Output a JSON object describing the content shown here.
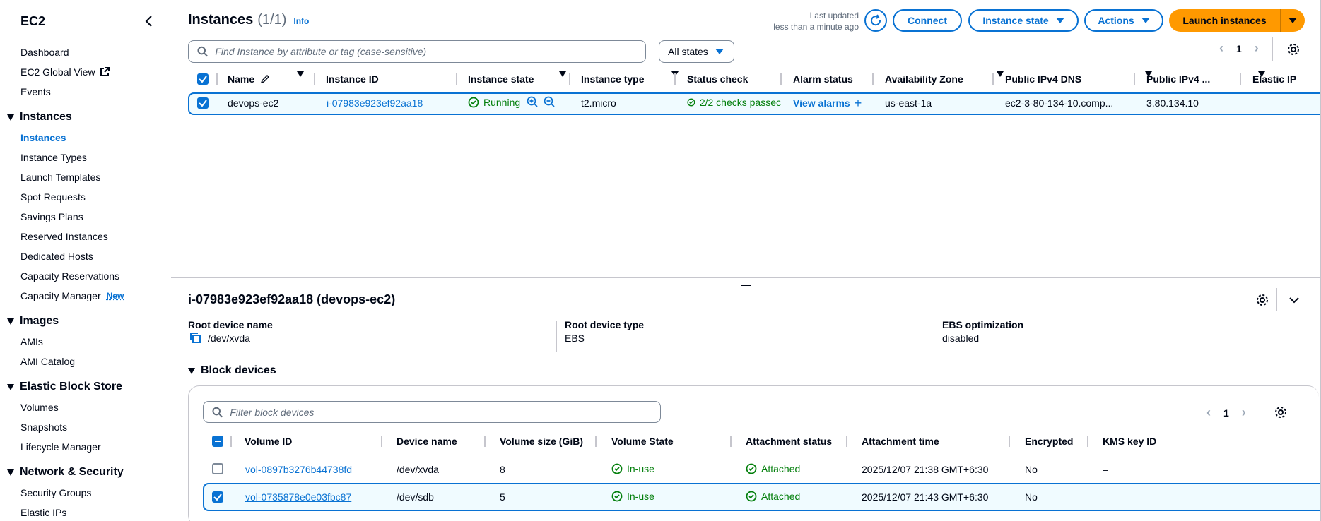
{
  "sidebar": {
    "title": "EC2",
    "top_items": [
      "Dashboard",
      "EC2 Global View",
      "Events"
    ],
    "sections": [
      {
        "title": "Instances",
        "items": [
          "Instances",
          "Instance Types",
          "Launch Templates",
          "Spot Requests",
          "Savings Plans",
          "Reserved Instances",
          "Dedicated Hosts",
          "Capacity Reservations",
          "Capacity Manager"
        ]
      },
      {
        "title": "Images",
        "items": [
          "AMIs",
          "AMI Catalog"
        ]
      },
      {
        "title": "Elastic Block Store",
        "items": [
          "Volumes",
          "Snapshots",
          "Lifecycle Manager"
        ]
      },
      {
        "title": "Network & Security",
        "items": [
          "Security Groups",
          "Elastic IPs"
        ]
      }
    ],
    "new_badge": "New"
  },
  "header": {
    "title": "Instances",
    "count": "(1/1)",
    "info": "Info",
    "last_updated_label": "Last updated",
    "last_updated_value": "less than a minute ago",
    "connect": "Connect",
    "instance_state": "Instance state",
    "actions": "Actions",
    "launch": "Launch instances"
  },
  "search": {
    "placeholder": "Find Instance by attribute or tag (case-sensitive)",
    "state_filter": "All states",
    "page": "1"
  },
  "instances_table": {
    "headers": {
      "name": "Name",
      "instance_id": "Instance ID",
      "instance_state": "Instance state",
      "instance_type": "Instance type",
      "status_check": "Status check",
      "alarm_status": "Alarm status",
      "az": "Availability Zone",
      "dns": "Public IPv4 DNS",
      "ipv4": "Public IPv4 ...",
      "elastic_ip": "Elastic IP"
    },
    "row": {
      "name": "devops-ec2",
      "instance_id": "i-07983e923ef92aa18",
      "state": "Running",
      "type": "t2.micro",
      "status_check": "2/2 checks passec",
      "alarm": "View alarms",
      "az": "us-east-1a",
      "dns": "ec2-3-80-134-10.comp...",
      "ipv4": "3.80.134.10",
      "elastic_ip": "–"
    }
  },
  "details": {
    "title": "i-07983e923ef92aa18 (devops-ec2)",
    "fields": {
      "root_device_name_label": "Root device name",
      "root_device_name": "/dev/xvda",
      "root_device_type_label": "Root device type",
      "root_device_type": "EBS",
      "ebs_opt_label": "EBS optimization",
      "ebs_opt": "disabled"
    },
    "block_devices_title": "Block devices",
    "filter_placeholder": "Filter block devices",
    "page": "1",
    "headers": {
      "volume_id": "Volume ID",
      "device_name": "Device name",
      "size": "Volume size (GiB)",
      "state": "Volume State",
      "attach_status": "Attachment status",
      "attach_time": "Attachment time",
      "encrypted": "Encrypted",
      "kms": "KMS key ID"
    },
    "rows": [
      {
        "volume_id": "vol-0897b3276b44738fd",
        "device": "/dev/xvda",
        "size": "8",
        "state": "In-use",
        "attach_status": "Attached",
        "attach_time": "2025/12/07 21:38 GMT+6:30",
        "encrypted": "No",
        "kms": "–"
      },
      {
        "volume_id": "vol-0735878e0e03fbc87",
        "device": "/dev/sdb",
        "size": "5",
        "state": "In-use",
        "attach_status": "Attached",
        "attach_time": "2025/12/07 21:43 GMT+6:30",
        "encrypted": "No",
        "kms": "–"
      }
    ]
  }
}
